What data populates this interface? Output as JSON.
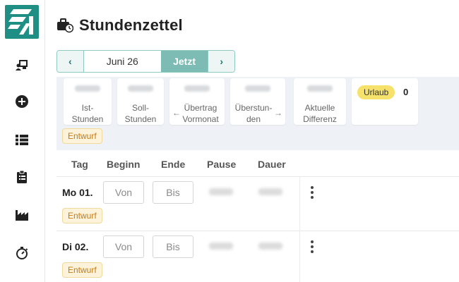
{
  "app": {
    "brand_color": "#1f8f86",
    "accent_color": "#7cbcb5",
    "sidebar_icons": [
      "logo-icon",
      "user-desk-icon",
      "plus-circle-icon",
      "list-icon",
      "clipboard-icon",
      "factory-icon",
      "stopwatch-icon"
    ]
  },
  "header": {
    "title": "Stundenzettel",
    "icon": "briefcase-clock-icon"
  },
  "period": {
    "prev_label": "‹",
    "month_label": "Juni 26",
    "today_label": "Jetzt",
    "next_label": "›"
  },
  "summary": {
    "ist_line1": "Ist-",
    "ist_line2": "Stunden",
    "soll_line1": "Soll-",
    "soll_line2": "Stunden",
    "uebertrag_line1": "Übertrag",
    "uebertrag_line2": "Vormonat",
    "ueberstunden_line1": "Überstun-",
    "ueberstunden_line2": "den",
    "differenz_line1": "Aktuelle",
    "differenz_line2": "Differenz",
    "vacation_label": "Urlaub",
    "vacation_value": "0",
    "status": "Entwurf",
    "vacation_color": "#f6e26b"
  },
  "table": {
    "headers": {
      "day": "Tag",
      "start": "Beginn",
      "end": "Ende",
      "pause": "Pause",
      "duration": "Dauer"
    },
    "rows": [
      {
        "day": "Mo 01.",
        "from_placeholder": "Von",
        "to_placeholder": "Bis",
        "status": "Entwurf"
      },
      {
        "day": "Di 02.",
        "from_placeholder": "Von",
        "to_placeholder": "Bis",
        "status": "Entwurf"
      }
    ]
  }
}
